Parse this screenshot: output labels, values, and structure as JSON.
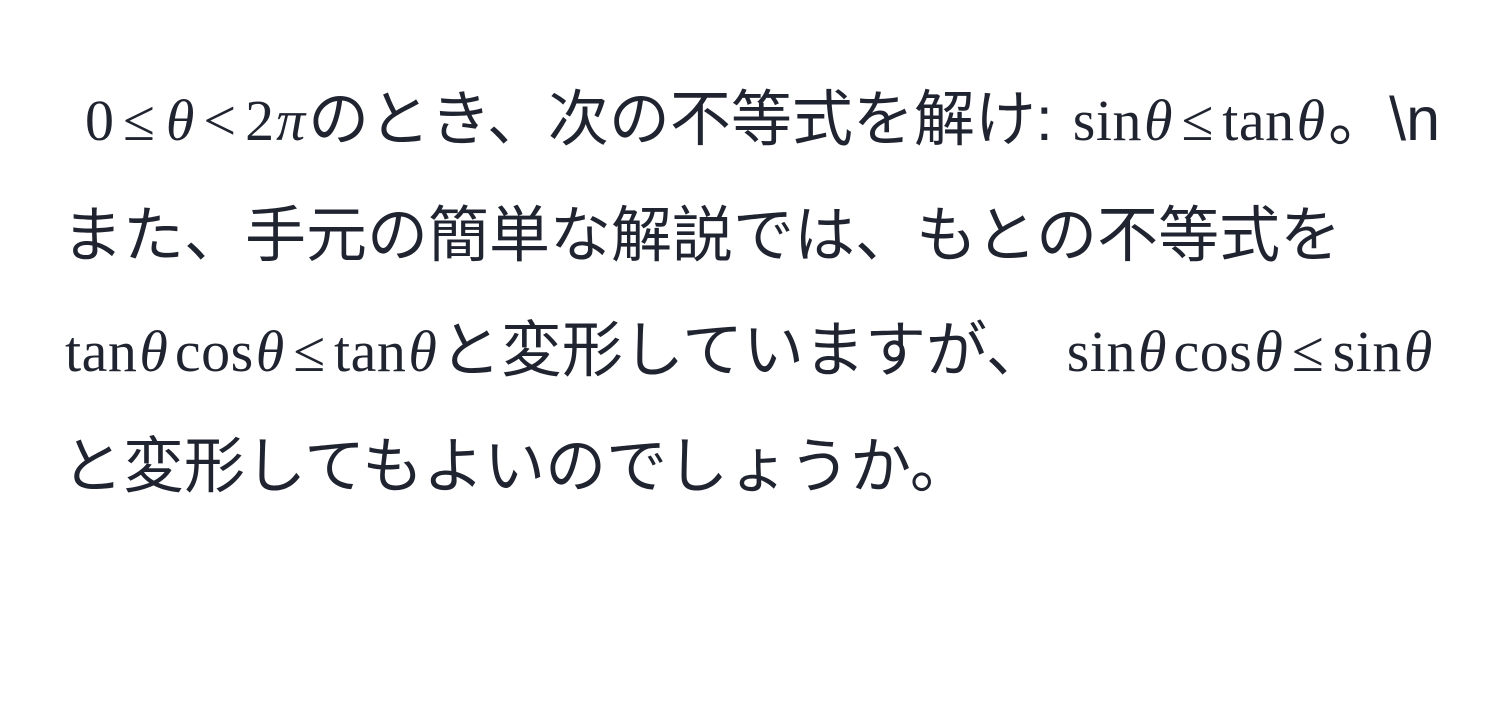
{
  "document": {
    "background_color": "#ffffff",
    "text_color": "#1f2430",
    "language": "ja",
    "kind": "math-question-text"
  },
  "question": {
    "full_text": "0 ≤ θ < 2π のとき、次の不等式を解け: sin θ ≤ tan θ 。\\nまた、手元の簡単な解説では、もとの不等式を tan θ cos θ ≤ tan θ と変形していますが、 sin θ cos θ ≤ sin θ と変形してもよいのでしょうか。",
    "segments": {
      "range_condition": {
        "zero": "0",
        "le": "≤",
        "theta": "θ",
        "lt": "<",
        "two": "2",
        "pi": "π"
      },
      "prose_1": "のとき、次の不等式を解け:",
      "inequality_main": {
        "sin": "sin",
        "theta_1": "θ",
        "le": "≤",
        "tan": "tan",
        "theta_2": "θ"
      },
      "punct_1": "。",
      "escape_newline": "\\n",
      "prose_2": "また、手元の簡単な解説では、もとの不等式を",
      "transform_given": {
        "tan_1": "tan",
        "theta_1": "θ",
        "cos": "cos",
        "theta_2": "θ",
        "le": "≤",
        "tan_2": "tan",
        "theta_3": "θ"
      },
      "prose_3": "と変形していますが、",
      "transform_alt": {
        "sin_1": "sin",
        "theta_1": "θ",
        "cos": "cos",
        "theta_2": "θ",
        "le": "≤",
        "sin_2": "sin",
        "theta_3": "θ"
      },
      "prose_4": "と変形してもよいのでしょうか。"
    }
  }
}
